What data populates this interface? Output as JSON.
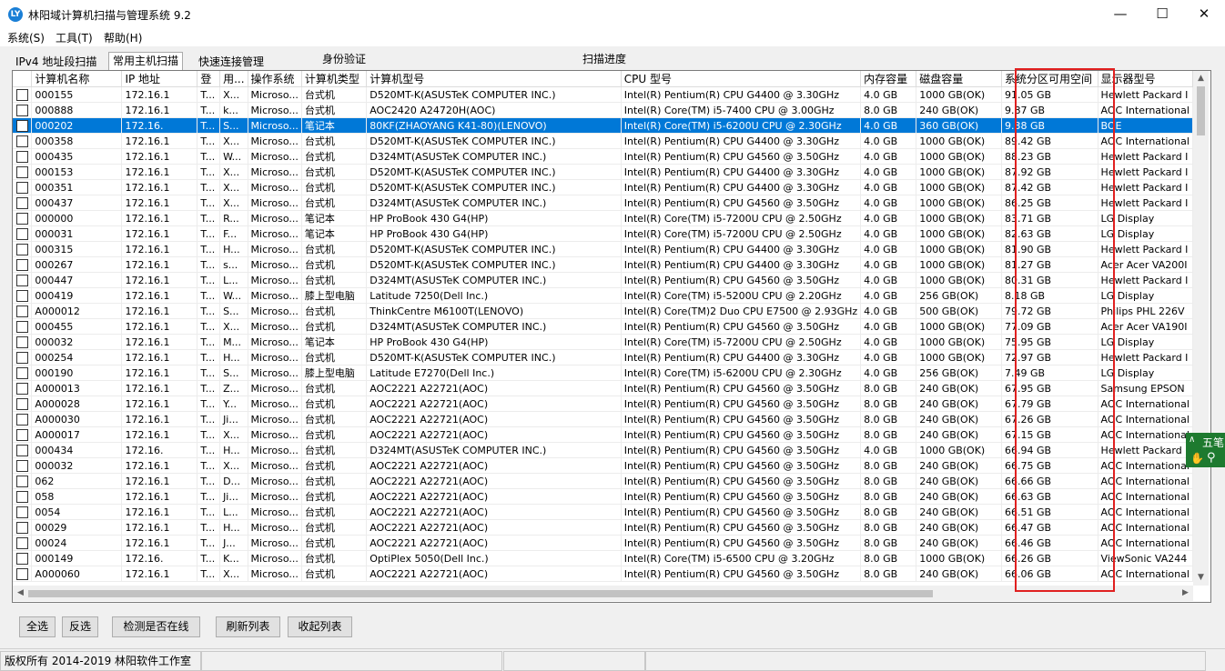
{
  "window": {
    "title": "林阳域计算机扫描与管理系统 9.2",
    "app_icon": "LY"
  },
  "menu": [
    "系统(S)",
    "工具(T)",
    "帮助(H)"
  ],
  "tabs": [
    "IPv4 地址段扫描",
    "常用主机扫描",
    "快速连接管理",
    "身份验证",
    "扫描进度"
  ],
  "columns": [
    "",
    "计算机名称",
    "IP 地址",
    "登",
    "用...",
    "操作系统",
    "计算机类型",
    "计算机型号",
    "CPU 型号",
    "内存容量",
    "磁盘容量",
    "系统分区可用空间",
    "显示器型号"
  ],
  "rows": [
    [
      "",
      "000155",
      "172.16.1",
      "T...",
      "X...",
      "Microso...",
      "台式机",
      "D520MT-K(ASUSTeK COMPUTER INC.)",
      "Intel(R) Pentium(R) CPU G4400 @ 3.30GHz",
      "4.0 GB",
      "1000 GB(OK)",
      "91.05 GB",
      "Hewlett Packard I"
    ],
    [
      "",
      "000888",
      "172.16.1",
      "T...",
      "k...",
      "Microso...",
      "台式机",
      "AOC2420 A24720H(AOC)",
      "Intel(R) Core(TM) i5-7400 CPU @ 3.00GHz",
      "8.0 GB",
      "240 GB(OK)",
      "9.87 GB",
      "AOC International"
    ],
    [
      "",
      "000202",
      "172.16.",
      "T...",
      "S...",
      "Microso...",
      "笔记本",
      "80KF(ZHAOYANG K41-80)(LENOVO)",
      "Intel(R) Core(TM) i5-6200U CPU @ 2.30GHz",
      "4.0 GB",
      "360 GB(OK)",
      "9.38 GB",
      "BOE"
    ],
    [
      "",
      "000358",
      "172.16.1",
      "T...",
      "X...",
      "Microso...",
      "台式机",
      "D520MT-K(ASUSTeK COMPUTER INC.)",
      "Intel(R) Pentium(R) CPU G4400 @ 3.30GHz",
      "4.0 GB",
      "1000 GB(OK)",
      "89.42 GB",
      "AOC International"
    ],
    [
      "",
      "000435",
      "172.16.1",
      "T...",
      "W...",
      "Microso...",
      "台式机",
      "D324MT(ASUSTeK COMPUTER INC.)",
      "Intel(R) Pentium(R) CPU G4560 @ 3.50GHz",
      "4.0 GB",
      "1000 GB(OK)",
      "88.23 GB",
      "Hewlett Packard I"
    ],
    [
      "",
      "000153",
      "172.16.1",
      "T...",
      "X...",
      "Microso...",
      "台式机",
      "D520MT-K(ASUSTeK COMPUTER INC.)",
      "Intel(R) Pentium(R) CPU G4400 @ 3.30GHz",
      "4.0 GB",
      "1000 GB(OK)",
      "87.92 GB",
      "Hewlett Packard I"
    ],
    [
      "",
      "000351",
      "172.16.1",
      "T...",
      "X...",
      "Microso...",
      "台式机",
      "D520MT-K(ASUSTeK COMPUTER INC.)",
      "Intel(R) Pentium(R) CPU G4400 @ 3.30GHz",
      "4.0 GB",
      "1000 GB(OK)",
      "87.42 GB",
      "Hewlett Packard I"
    ],
    [
      "",
      "000437",
      "172.16.1",
      "T...",
      "X...",
      "Microso...",
      "台式机",
      "D324MT(ASUSTeK COMPUTER INC.)",
      "Intel(R) Pentium(R) CPU G4560 @ 3.50GHz",
      "4.0 GB",
      "1000 GB(OK)",
      "86.25 GB",
      "Hewlett Packard I"
    ],
    [
      "",
      "000000",
      "172.16.1",
      "T...",
      "R...",
      "Microso...",
      "笔记本",
      "HP ProBook 430 G4(HP)",
      "Intel(R) Core(TM) i5-7200U CPU @ 2.50GHz",
      "4.0 GB",
      "1000 GB(OK)",
      "83.71 GB",
      "LG Display"
    ],
    [
      "",
      "000031",
      "172.16.1",
      "T...",
      "F...",
      "Microso...",
      "笔记本",
      "HP ProBook 430 G4(HP)",
      "Intel(R) Core(TM) i5-7200U CPU @ 2.50GHz",
      "4.0 GB",
      "1000 GB(OK)",
      "82.63 GB",
      "LG Display"
    ],
    [
      "",
      "000315",
      "172.16.1",
      "T...",
      "H...",
      "Microso...",
      "台式机",
      "D520MT-K(ASUSTeK COMPUTER INC.)",
      "Intel(R) Pentium(R) CPU G4400 @ 3.30GHz",
      "4.0 GB",
      "1000 GB(OK)",
      "81.90 GB",
      "Hewlett Packard I"
    ],
    [
      "",
      "000267",
      "172.16.1",
      "T...",
      "s...",
      "Microso...",
      "台式机",
      "D520MT-K(ASUSTeK COMPUTER INC.)",
      "Intel(R) Pentium(R) CPU G4400 @ 3.30GHz",
      "4.0 GB",
      "1000 GB(OK)",
      "81.27 GB",
      "Acer Acer VA200I"
    ],
    [
      "",
      "000447",
      "172.16.1",
      "T...",
      "L...",
      "Microso...",
      "台式机",
      "D324MT(ASUSTeK COMPUTER INC.)",
      "Intel(R) Pentium(R) CPU G4560 @ 3.50GHz",
      "4.0 GB",
      "1000 GB(OK)",
      "80.31 GB",
      "Hewlett Packard I"
    ],
    [
      "",
      "000419",
      "172.16.1",
      "T...",
      "W...",
      "Microso...",
      "膝上型电脑",
      "Latitude 7250(Dell Inc.)",
      "Intel(R) Core(TM) i5-5200U CPU @ 2.20GHz",
      "4.0 GB",
      "256 GB(OK)",
      "8.18 GB",
      "LG Display"
    ],
    [
      "",
      "A000012",
      "172.16.1",
      "T...",
      "S...",
      "Microso...",
      "台式机",
      "ThinkCentre M6100T(LENOVO)",
      "Intel(R) Core(TM)2 Duo CPU     E7500  @ 2.93GHz",
      "4.0 GB",
      "500 GB(OK)",
      "79.72 GB",
      "Philips PHL 226V"
    ],
    [
      "",
      "000455",
      "172.16.1",
      "T...",
      "X...",
      "Microso...",
      "台式机",
      "D324MT(ASUSTeK COMPUTER INC.)",
      "Intel(R) Pentium(R) CPU G4560 @ 3.50GHz",
      "4.0 GB",
      "1000 GB(OK)",
      "77.09 GB",
      "Acer Acer VA190I"
    ],
    [
      "",
      "000032",
      "172.16.1",
      "T...",
      "M...",
      "Microso...",
      "笔记本",
      "HP ProBook 430 G4(HP)",
      "Intel(R) Core(TM) i5-7200U CPU @ 2.50GHz",
      "4.0 GB",
      "1000 GB(OK)",
      "75.95 GB",
      "LG Display"
    ],
    [
      "",
      "000254",
      "172.16.1",
      "T...",
      "H...",
      "Microso...",
      "台式机",
      "D520MT-K(ASUSTeK COMPUTER INC.)",
      "Intel(R) Pentium(R) CPU G4400 @ 3.30GHz",
      "4.0 GB",
      "1000 GB(OK)",
      "72.97 GB",
      "Hewlett Packard I"
    ],
    [
      "",
      "000190",
      "172.16.1",
      "T...",
      "S...",
      "Microso...",
      "膝上型电脑",
      "Latitude E7270(Dell Inc.)",
      "Intel(R) Core(TM) i5-6200U CPU @ 2.30GHz",
      "4.0 GB",
      "256 GB(OK)",
      "7.49 GB",
      "LG Display"
    ],
    [
      "",
      "A000013",
      "172.16.1",
      "T...",
      "Z...",
      "Microso...",
      "台式机",
      "AOC2221 A22721(AOC)",
      "Intel(R) Pentium(R) CPU G4560 @ 3.50GHz",
      "8.0 GB",
      "240 GB(OK)",
      "67.95 GB",
      "Samsung EPSON"
    ],
    [
      "",
      "A000028",
      "172.16.1",
      "T...",
      "Y...",
      "Microso...",
      "台式机",
      "AOC2221 A22721(AOC)",
      "Intel(R) Pentium(R) CPU G4560 @ 3.50GHz",
      "8.0 GB",
      "240 GB(OK)",
      "67.79 GB",
      "AOC International"
    ],
    [
      "",
      "A000030",
      "172.16.1",
      "T...",
      "Ji...",
      "Microso...",
      "台式机",
      "AOC2221 A22721(AOC)",
      "Intel(R) Pentium(R) CPU G4560 @ 3.50GHz",
      "8.0 GB",
      "240 GB(OK)",
      "67.26 GB",
      "AOC International"
    ],
    [
      "",
      "A000017",
      "172.16.1",
      "T...",
      "X...",
      "Microso...",
      "台式机",
      "AOC2221 A22721(AOC)",
      "Intel(R) Pentium(R) CPU G4560 @ 3.50GHz",
      "8.0 GB",
      "240 GB(OK)",
      "67.15 GB",
      "AOC International"
    ],
    [
      "",
      "000434",
      "172.16.",
      "T...",
      "H...",
      "Microso...",
      "台式机",
      "D324MT(ASUSTeK COMPUTER INC.)",
      "Intel(R) Pentium(R) CPU G4560 @ 3.50GHz",
      "4.0 GB",
      "1000 GB(OK)",
      "66.94 GB",
      "Hewlett Packard I"
    ],
    [
      "",
      "000032",
      "172.16.1",
      "T...",
      "X...",
      "Microso...",
      "台式机",
      "AOC2221 A22721(AOC)",
      "Intel(R) Pentium(R) CPU G4560 @ 3.50GHz",
      "8.0 GB",
      "240 GB(OK)",
      "66.75 GB",
      "AOC International"
    ],
    [
      "",
      "062",
      "172.16.1",
      "T...",
      "D...",
      "Microso...",
      "台式机",
      "AOC2221 A22721(AOC)",
      "Intel(R) Pentium(R) CPU G4560 @ 3.50GHz",
      "8.0 GB",
      "240 GB(OK)",
      "66.66 GB",
      "AOC International"
    ],
    [
      "",
      "058",
      "172.16.1",
      "T...",
      "Ji...",
      "Microso...",
      "台式机",
      "AOC2221 A22721(AOC)",
      "Intel(R) Pentium(R) CPU G4560 @ 3.50GHz",
      "8.0 GB",
      "240 GB(OK)",
      "66.63 GB",
      "AOC International"
    ],
    [
      "",
      "0054",
      "172.16.1",
      "T...",
      "L...",
      "Microso...",
      "台式机",
      "AOC2221 A22721(AOC)",
      "Intel(R) Pentium(R) CPU G4560 @ 3.50GHz",
      "8.0 GB",
      "240 GB(OK)",
      "66.51 GB",
      "AOC International"
    ],
    [
      "",
      "00029",
      "172.16.1",
      "T...",
      "H...",
      "Microso...",
      "台式机",
      "AOC2221 A22721(AOC)",
      "Intel(R) Pentium(R) CPU G4560 @ 3.50GHz",
      "8.0 GB",
      "240 GB(OK)",
      "66.47 GB",
      "AOC International"
    ],
    [
      "",
      "00024",
      "172.16.1",
      "T...",
      "J...",
      "Microso...",
      "台式机",
      "AOC2221 A22721(AOC)",
      "Intel(R) Pentium(R) CPU G4560 @ 3.50GHz",
      "8.0 GB",
      "240 GB(OK)",
      "66.46 GB",
      "AOC International"
    ],
    [
      "",
      "000149",
      "172.16.",
      "T...",
      "K...",
      "Microso...",
      "台式机",
      "OptiPlex 5050(Dell Inc.)",
      "Intel(R) Core(TM) i5-6500 CPU @ 3.20GHz",
      "8.0 GB",
      "1000 GB(OK)",
      "66.26 GB",
      "ViewSonic VA244"
    ],
    [
      "",
      "A000060",
      "172.16.1",
      "T...",
      "X...",
      "Microso...",
      "台式机",
      "AOC2221 A22721(AOC)",
      "Intel(R) Pentium(R) CPU G4560 @ 3.50GHz",
      "8.0 GB",
      "240 GB(OK)",
      "66.06 GB",
      "AOC International"
    ]
  ],
  "selected_row": 2,
  "buttons": {
    "select_all": "全选",
    "invert": "反选",
    "check_online": "检测是否在线",
    "refresh": "刷新列表",
    "collapse": "收起列表"
  },
  "status": {
    "copyright": "版权所有 2014-2019 林阳软件工作室"
  },
  "ime": {
    "label": "五笔"
  },
  "colors": {
    "selection": "#0078d7",
    "highlight_box": "#e02020",
    "ime_bg": "#1e7a2f"
  }
}
